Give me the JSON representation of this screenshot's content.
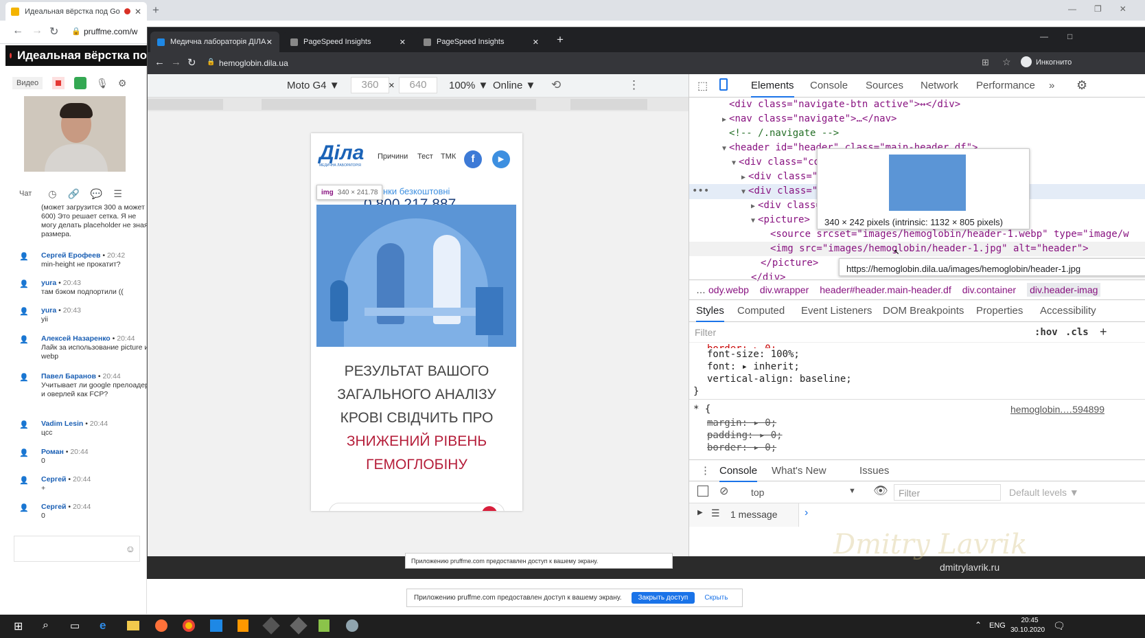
{
  "outer_browser": {
    "tab_title": "Идеальная вёрстка под Go",
    "new_tab": "+",
    "address": "pruffme.com/w"
  },
  "meeting": {
    "title": "Идеальная вёрстка по",
    "video_label": "Видео",
    "chat_label": "Чат",
    "messages": [
      {
        "who": "",
        "time": "",
        "text": "(может загрузится 300 а может 600) Это решает сетка. Я не могу делать placeholder не зная размера."
      },
      {
        "who": "Сергей Ерофеев",
        "time": "20:42",
        "text": "min-height не прокатит?"
      },
      {
        "who": "yura",
        "time": "20:43",
        "text": "там бэком подпортили (("
      },
      {
        "who": "yura",
        "time": "20:43",
        "text": "yii"
      },
      {
        "who": "Алексей Назаренко",
        "time": "20:44",
        "text": "Лайк за использование picture и webp"
      },
      {
        "who": "Павел Баранов",
        "time": "20:44",
        "text": "Учитывает ли google прелоадер и оверлей как FCP?"
      },
      {
        "who": "Vadim Lesin",
        "time": "20:44",
        "text": "цсс"
      },
      {
        "who": "Роман",
        "time": "20:44",
        "text": "0"
      },
      {
        "who": "Сергей",
        "time": "20:44",
        "text": "+"
      },
      {
        "who": "Сергей",
        "time": "20:44",
        "text": "0"
      }
    ]
  },
  "inner_browser": {
    "tabs": [
      "Медична лабораторія ДІЛА",
      "PageSpeed Insights",
      "PageSpeed Insights"
    ],
    "address": "hemoglobin.dila.ua",
    "incognito": "Инкогнито"
  },
  "device_toolbar": {
    "device": "Moto G4 ▼",
    "width": "360",
    "times": "×",
    "height": "640",
    "zoom": "100% ▼",
    "network": "Online ▼"
  },
  "page": {
    "logo": "Діла",
    "logo_sub": "МЕДИЧНА ЛАБОРАТОРІЯ",
    "nav": [
      "Причини",
      "Тест",
      "ТМК"
    ],
    "img_hint_tag": "img",
    "img_hint_size": "340 × 241.78",
    "free_calls": "нки безкоштовні",
    "phone": "0 800 217 887",
    "headline_1": "РЕЗУЛЬТАТ ВАШОГО",
    "headline_2": "ЗАГАЛЬНОГО АНАЛІЗУ",
    "headline_3": "КРОВІ СВІДЧИТЬ ПРО",
    "headline_red_1": "ЗНИЖЕНИЙ РІВЕНЬ",
    "headline_red_2": "ГЕМОГЛОБІНУ"
  },
  "devtools": {
    "tabs": [
      "Elements",
      "Console",
      "Sources",
      "Network",
      "Performance",
      "»"
    ],
    "dom_lines": [
      {
        "indent": 0,
        "arrow": "",
        "text": "<div class=\"navigate-btn active\">↔</div>"
      },
      {
        "indent": 0,
        "arrow": "▶",
        "text": "<nav class=\"navigate\">…</nav>"
      },
      {
        "indent": 0,
        "arrow": "",
        "text": "<!-- /.navigate -->"
      },
      {
        "indent": 0,
        "arrow": "▼",
        "text": "<header id=\"header\" class=\"main-header df\">"
      },
      {
        "indent": 1,
        "arrow": "▼",
        "text": "<div class=\"co"
      },
      {
        "indent": 2,
        "arrow": "▶",
        "text": "<div class=\""
      },
      {
        "indent": 2,
        "arrow": "▼",
        "text": "<div class=\""
      },
      {
        "indent": 3,
        "arrow": "▶",
        "text": "<div class="
      },
      {
        "indent": 3,
        "arrow": "▼",
        "text": "<picture>"
      },
      {
        "indent": 4,
        "arrow": "",
        "text": "<source srcset=\"images/hemoglobin/header-1.webp\" type=\"image/w"
      },
      {
        "indent": 4,
        "arrow": "",
        "text": "<img src=\"images/hemoglobin/header-1.jpg\" alt=\"header\">"
      },
      {
        "indent": 3,
        "arrow": "",
        "text": "</picture>"
      },
      {
        "indent": 2,
        "arrow": "",
        "text": "</div>"
      }
    ],
    "tooltip_size": "340 × 242 pixels (intrinsic: 1132 × 805 pixels)",
    "url_tooltip": "https://hemoglobin.dila.ua/images/hemoglobin/header-1.jpg",
    "breadcrumbs": [
      "…",
      "ody.webp",
      "div.wrapper",
      "header#header.main-header.df",
      "div.container",
      "div.header-imag"
    ],
    "subtabs": [
      "Styles",
      "Computed",
      "Event Listeners",
      "DOM Breakpoints",
      "Properties",
      "Accessibility"
    ],
    "filter_placeholder": "Filter",
    "hov": ":hov",
    "cls": ".cls",
    "plus": "+",
    "style_lines": [
      "border: ▸ 0;",
      "font-size: 100%;",
      "font: ▸ inherit;",
      "vertical-align: baseline;",
      "}"
    ],
    "universal_selector": "* {",
    "source_link": "hemoglobin.…594899",
    "struck_lines": [
      "margin: ▸ 0;",
      "padding: ▸ 0;",
      "border: ▸ 0;"
    ],
    "drawer_tabs": [
      "Console",
      "What's New",
      "Issues"
    ],
    "context": "top",
    "console_filter": "Filter",
    "levels": "Default levels ▼",
    "messages": "1 message",
    "prompt": "›"
  },
  "share": {
    "text": "Приложению pruffme.com предоставлен доступ к вашему экрану.",
    "close_btn": "Закрыть доступ",
    "hide_btn": "Скрыть"
  },
  "taskbar": {
    "lang": "ENG",
    "time": "20:45",
    "date": "30.10.2020"
  },
  "watermark": "dmitrylavrik.ru",
  "colors": {
    "devtools_blue": "#1a73e8",
    "headline_red": "#b51e3a",
    "illustration_blue": "#3f8fd6"
  }
}
